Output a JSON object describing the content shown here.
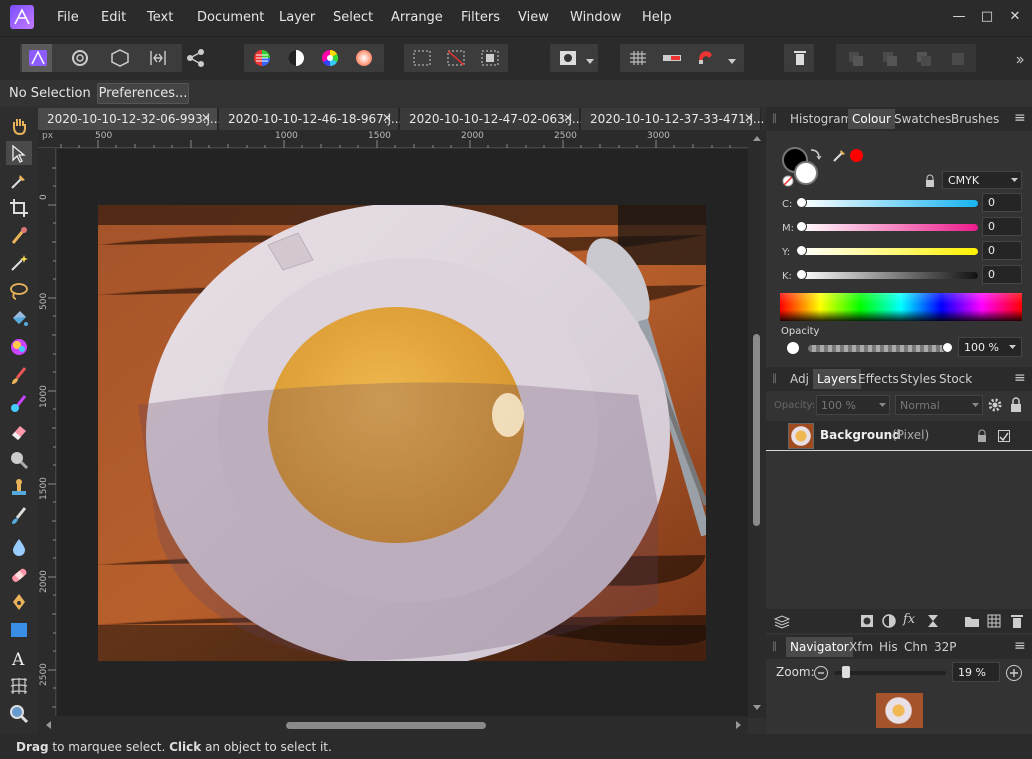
{
  "menu": [
    "File",
    "Edit",
    "Text",
    "Document",
    "Layer",
    "Select",
    "Arrange",
    "Filters",
    "View",
    "Window",
    "Help"
  ],
  "window_controls": {
    "min": "—",
    "max": "□",
    "close": "✕"
  },
  "context": {
    "selection": "No Selection",
    "preferences": "Preferences..."
  },
  "doc_tabs": [
    {
      "label": "2020-10-10-12-32-06-993.j...",
      "close": "✕"
    },
    {
      "label": "2020-10-10-12-46-18-967.j...",
      "close": "✕"
    },
    {
      "label": "2020-10-10-12-47-02-063.j...",
      "close": "✕"
    },
    {
      "label": "2020-10-10-12-37-33-471.j...",
      "close": "✕"
    }
  ],
  "ruler": {
    "unit": "px",
    "top_ticks": [
      "500",
      "1000",
      "1500",
      "2000",
      "2500",
      "3000"
    ],
    "left_ticks": [
      "0",
      "500",
      "1000",
      "1500",
      "2000",
      "2500"
    ]
  },
  "colour_panel": {
    "tabs": [
      "Histogram",
      "Colour",
      "Swatches",
      "Brushes"
    ],
    "active_tab": "Colour",
    "model": "CMYK",
    "sliders": [
      {
        "label": "C:",
        "value": "0"
      },
      {
        "label": "M:",
        "value": "0"
      },
      {
        "label": "Y:",
        "value": "0"
      },
      {
        "label": "K:",
        "value": "0"
      }
    ],
    "opacity_label": "Opacity",
    "opacity_value": "100 %"
  },
  "layers_panel": {
    "tabs": [
      "Adj",
      "Layers",
      "Effects",
      "Styles",
      "Stock"
    ],
    "active_tab": "Layers",
    "opacity_label": "Opacity:",
    "opacity_value": "100 %",
    "blend_mode": "Normal",
    "layer_name": "Background",
    "layer_type": "(Pixel)"
  },
  "navigator_panel": {
    "tabs": [
      "Navigator",
      "Xfm",
      "His",
      "Chn",
      "32P"
    ],
    "active_tab": "Navigator",
    "zoom_label": "Zoom:",
    "zoom_value": "19 %"
  },
  "status": {
    "drag": "Drag",
    "drag_text": " to marquee select. ",
    "click": "Click",
    "click_text": " an object to select it."
  },
  "colors": {
    "accent": "#9b5cff",
    "primary_fill": "#000000",
    "secondary_fill": "#ffffff",
    "picker_red": "#ff0000"
  }
}
